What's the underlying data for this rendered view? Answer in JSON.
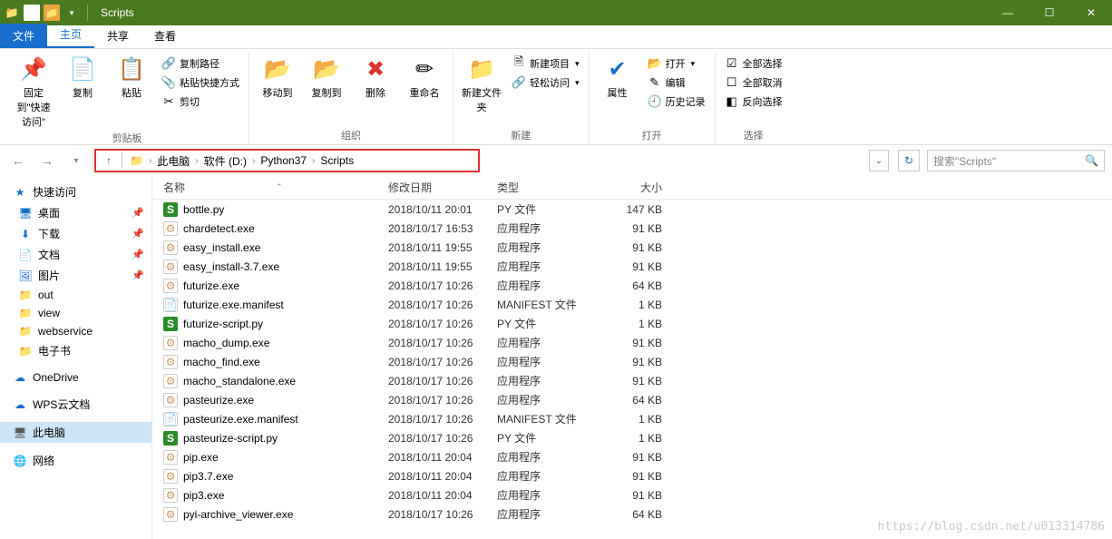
{
  "window": {
    "title": "Scripts"
  },
  "tabs": {
    "file": "文件",
    "home": "主页",
    "share": "共享",
    "view": "查看"
  },
  "ribbon": {
    "pin": "固定到\"快速访问\"",
    "copy": "复制",
    "paste": "粘贴",
    "copyPath": "复制路径",
    "pasteShortcut": "粘贴快捷方式",
    "cut": "剪切",
    "clipboard": "剪贴板",
    "moveTo": "移动到",
    "copyTo": "复制到",
    "delete": "删除",
    "rename": "重命名",
    "organize": "组织",
    "newFolder": "新建文件夹",
    "newItem": "新建项目",
    "easyAccess": "轻松访问",
    "new": "新建",
    "properties": "属性",
    "open": "打开",
    "edit": "编辑",
    "history": "历史记录",
    "openGroup": "打开",
    "selectAll": "全部选择",
    "selectNone": "全部取消",
    "invertSel": "反向选择",
    "select": "选择"
  },
  "breadcrumb": {
    "pc": "此电脑",
    "drive": "软件 (D:)",
    "py": "Python37",
    "scripts": "Scripts"
  },
  "search": {
    "placeholder": "搜索\"Scripts\""
  },
  "sidebar": {
    "quick": "快速访问",
    "desktop": "桌面",
    "downloads": "下载",
    "documents": "文档",
    "pictures": "图片",
    "out": "out",
    "view": "view",
    "webservice": "webservice",
    "ebook": "电子书",
    "onedrive": "OneDrive",
    "wps": "WPS云文档",
    "thispc": "此电脑",
    "network": "网络"
  },
  "columns": {
    "name": "名称",
    "date": "修改日期",
    "type": "类型",
    "size": "大小"
  },
  "files": [
    {
      "name": "bottle.py",
      "date": "2018/10/11 20:01",
      "type": "PY 文件",
      "size": "147 KB",
      "icon": "py"
    },
    {
      "name": "chardetect.exe",
      "date": "2018/10/17 16:53",
      "type": "应用程序",
      "size": "91 KB",
      "icon": "exe"
    },
    {
      "name": "easy_install.exe",
      "date": "2018/10/11 19:55",
      "type": "应用程序",
      "size": "91 KB",
      "icon": "exe"
    },
    {
      "name": "easy_install-3.7.exe",
      "date": "2018/10/11 19:55",
      "type": "应用程序",
      "size": "91 KB",
      "icon": "exe"
    },
    {
      "name": "futurize.exe",
      "date": "2018/10/17 10:26",
      "type": "应用程序",
      "size": "64 KB",
      "icon": "exe"
    },
    {
      "name": "futurize.exe.manifest",
      "date": "2018/10/17 10:26",
      "type": "MANIFEST 文件",
      "size": "1 KB",
      "icon": "manifest"
    },
    {
      "name": "futurize-script.py",
      "date": "2018/10/17 10:26",
      "type": "PY 文件",
      "size": "1 KB",
      "icon": "py"
    },
    {
      "name": "macho_dump.exe",
      "date": "2018/10/17 10:26",
      "type": "应用程序",
      "size": "91 KB",
      "icon": "exe"
    },
    {
      "name": "macho_find.exe",
      "date": "2018/10/17 10:26",
      "type": "应用程序",
      "size": "91 KB",
      "icon": "exe"
    },
    {
      "name": "macho_standalone.exe",
      "date": "2018/10/17 10:26",
      "type": "应用程序",
      "size": "91 KB",
      "icon": "exe"
    },
    {
      "name": "pasteurize.exe",
      "date": "2018/10/17 10:26",
      "type": "应用程序",
      "size": "64 KB",
      "icon": "exe"
    },
    {
      "name": "pasteurize.exe.manifest",
      "date": "2018/10/17 10:26",
      "type": "MANIFEST 文件",
      "size": "1 KB",
      "icon": "manifest"
    },
    {
      "name": "pasteurize-script.py",
      "date": "2018/10/17 10:26",
      "type": "PY 文件",
      "size": "1 KB",
      "icon": "py"
    },
    {
      "name": "pip.exe",
      "date": "2018/10/11 20:04",
      "type": "应用程序",
      "size": "91 KB",
      "icon": "exe"
    },
    {
      "name": "pip3.7.exe",
      "date": "2018/10/11 20:04",
      "type": "应用程序",
      "size": "91 KB",
      "icon": "exe"
    },
    {
      "name": "pip3.exe",
      "date": "2018/10/11 20:04",
      "type": "应用程序",
      "size": "91 KB",
      "icon": "exe"
    },
    {
      "name": "pyi-archive_viewer.exe",
      "date": "2018/10/17 10:26",
      "type": "应用程序",
      "size": "64 KB",
      "icon": "exe"
    }
  ],
  "watermark": "https://blog.csdn.net/u013314786"
}
